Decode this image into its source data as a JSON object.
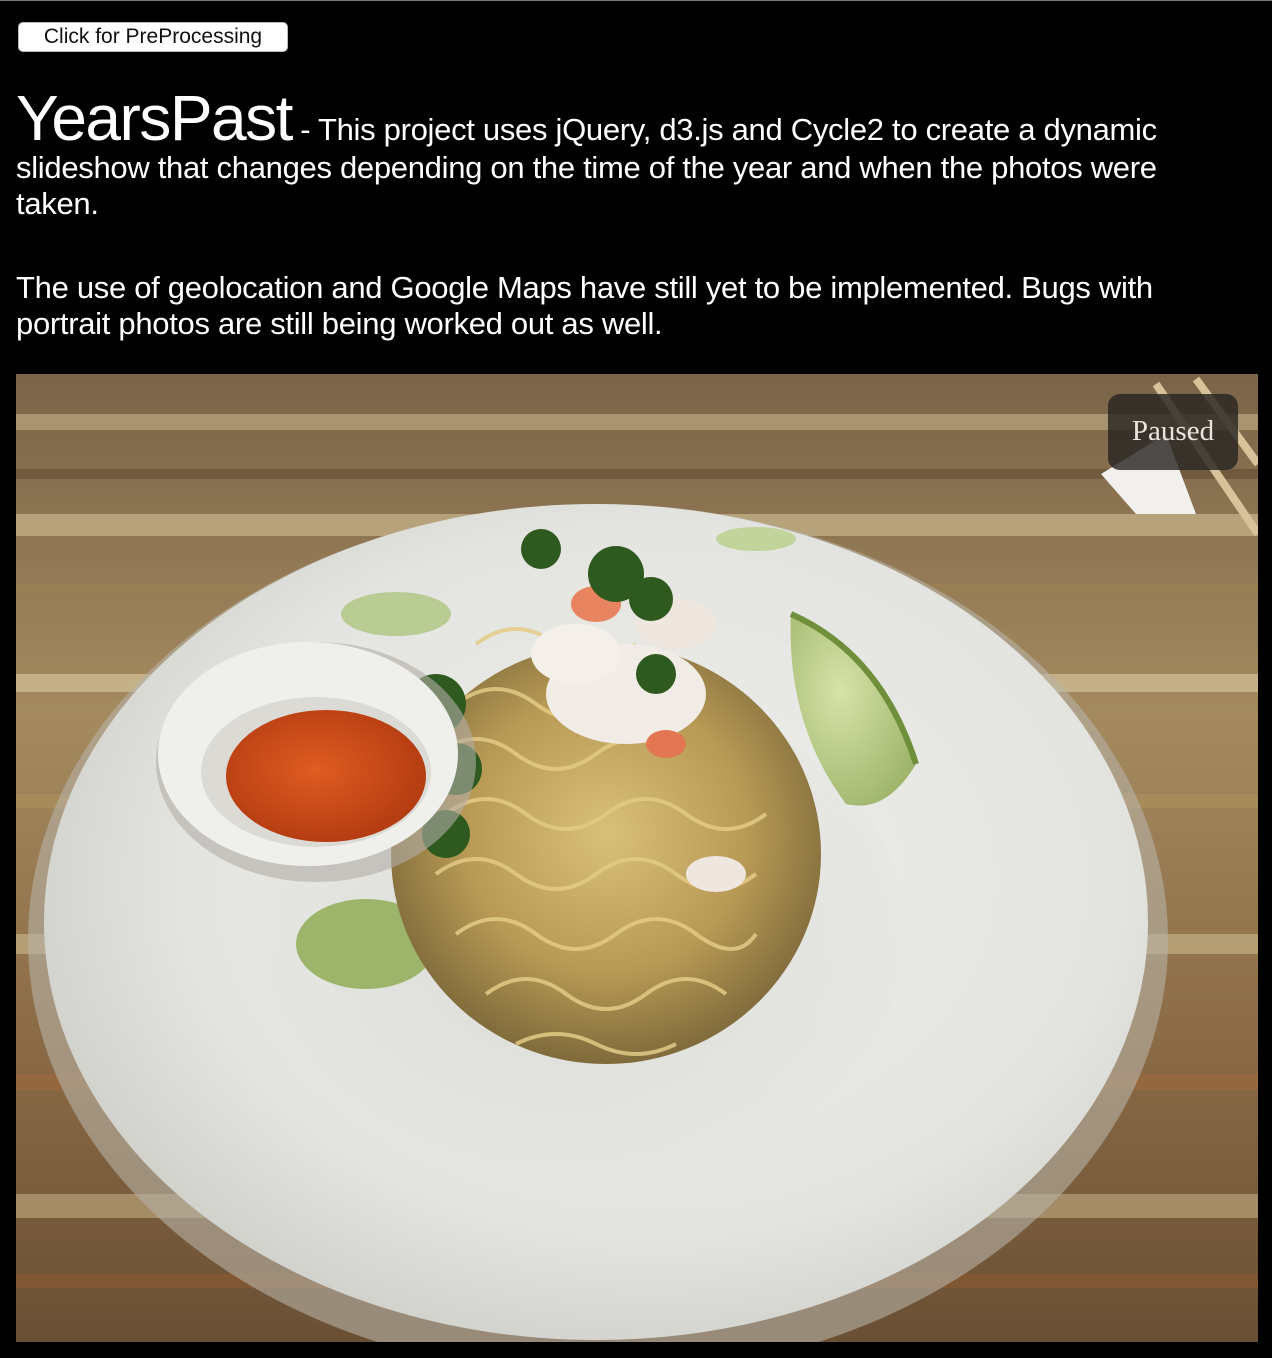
{
  "toolbar": {
    "preprocess_label": "Click for PreProcessing"
  },
  "intro": {
    "brand": "YearsPast",
    "description": " - This project uses jQuery, d3.js and Cycle2 to create a dynamic slideshow that changes depending on the time of the year and when the photos were taken.",
    "note": "The use of geolocation and Google Maps have still yet to be implemented. Bugs with portrait photos are still being worked out as well."
  },
  "slideshow": {
    "status": "Paused",
    "photo_subject": "noodle-dish-photo"
  },
  "colors": {
    "page_background": "#000000",
    "text": "#ffffff",
    "button_background": "#ffffff",
    "status_overlay": "#282422"
  }
}
